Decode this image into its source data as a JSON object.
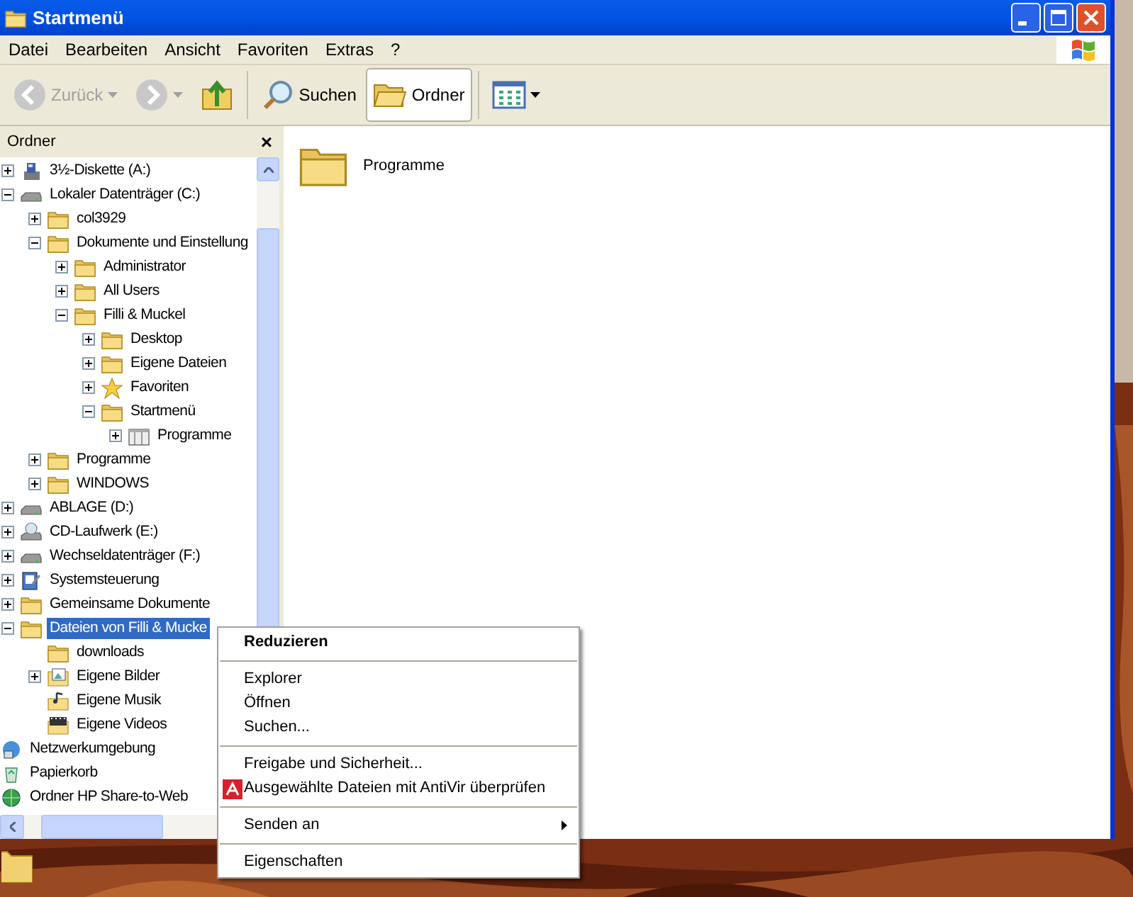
{
  "window": {
    "title": "Startmenü"
  },
  "menu_bar": [
    "Datei",
    "Bearbeiten",
    "Ansicht",
    "Favoriten",
    "Extras",
    "?"
  ],
  "toolbar": [
    {
      "kind": "back",
      "label": "Zurück",
      "disabled": true,
      "dropdown": true,
      "selected": false
    },
    {
      "kind": "forward",
      "disabled": true,
      "dropdown": true,
      "selected": false
    },
    {
      "kind": "up",
      "disabled": false,
      "dropdown": false,
      "selected": false
    },
    {
      "kind": "search",
      "label": "Suchen",
      "disabled": false,
      "dropdown": false,
      "selected": false
    },
    {
      "kind": "folders",
      "label": "Ordner",
      "disabled": false,
      "dropdown": false,
      "selected": true
    },
    {
      "kind": "views",
      "disabled": false,
      "dropdown": true,
      "selected": false
    }
  ],
  "folder_pane": {
    "title": "Ordner",
    "close": "×",
    "tree": [
      {
        "label": "3½-Diskette (A:)",
        "kind": "floppy",
        "expanded": false,
        "selected": false
      },
      {
        "label": "Lokaler Datenträger (C:)",
        "kind": "drive",
        "expanded": true,
        "selected": false,
        "children": [
          {
            "label": "col3929",
            "kind": "folder",
            "expanded": false,
            "selected": false
          },
          {
            "label": "Dokumente und Einstellung",
            "kind": "folder",
            "expanded": true,
            "selected": false,
            "children": [
              {
                "label": "Administrator",
                "kind": "folder",
                "expanded": false,
                "selected": false
              },
              {
                "label": "All Users",
                "kind": "folder",
                "expanded": false,
                "selected": false
              },
              {
                "label": "Filli & Muckel",
                "kind": "folder",
                "expanded": true,
                "selected": false,
                "children": [
                  {
                    "label": "Desktop",
                    "kind": "folder",
                    "expanded": false,
                    "selected": false
                  },
                  {
                    "label": "Eigene Dateien",
                    "kind": "folder",
                    "expanded": false,
                    "selected": false
                  },
                  {
                    "label": "Favoriten",
                    "kind": "star",
                    "expanded": false,
                    "selected": false
                  },
                  {
                    "label": "Startmenü",
                    "kind": "folder",
                    "expanded": true,
                    "selected": false,
                    "children": [
                      {
                        "label": "Programme",
                        "kind": "programs",
                        "expanded": false,
                        "selected": false
                      }
                    ]
                  }
                ]
              }
            ]
          },
          {
            "label": "Programme",
            "kind": "folder",
            "expanded": false,
            "selected": false
          },
          {
            "label": "WINDOWS",
            "kind": "folder",
            "expanded": false,
            "selected": false
          }
        ]
      },
      {
        "label": "ABLAGE (D:)",
        "kind": "drive",
        "expanded": false,
        "selected": false
      },
      {
        "label": "CD-Laufwerk (E:)",
        "kind": "cdrom",
        "expanded": false,
        "selected": false
      },
      {
        "label": "Wechseldatenträger (F:)",
        "kind": "drive",
        "expanded": false,
        "selected": false
      },
      {
        "label": "Systemsteuerung",
        "kind": "control",
        "expanded": false,
        "selected": false
      },
      {
        "label": "Gemeinsame Dokumente",
        "kind": "folder",
        "expanded": false,
        "selected": false
      },
      {
        "label": "Dateien von Filli & Mucke",
        "kind": "folder",
        "expanded": true,
        "selected": true,
        "children": [
          {
            "label": "downloads",
            "kind": "folder",
            "selected": false
          },
          {
            "label": "Eigene Bilder",
            "kind": "pictures",
            "expanded": false,
            "selected": false
          },
          {
            "label": "Eigene Musik",
            "kind": "music",
            "selected": false
          },
          {
            "label": "Eigene Videos",
            "kind": "videos",
            "selected": false
          }
        ]
      },
      {
        "label": "Netzwerkumgebung",
        "kind": "network",
        "selected": false
      },
      {
        "label": "Papierkorb",
        "kind": "recycle",
        "selected": false
      },
      {
        "label": "Ordner HP Share-to-Web",
        "kind": "web",
        "selected": false
      }
    ]
  },
  "content": {
    "items": [
      {
        "label": "Programme",
        "kind": "folder"
      }
    ]
  },
  "context_menu": [
    {
      "kind": "item",
      "label": "Reduzieren",
      "default": true
    },
    {
      "kind": "separator"
    },
    {
      "kind": "item",
      "label": "Explorer",
      "default": false
    },
    {
      "kind": "item",
      "label": "Öffnen",
      "default": false
    },
    {
      "kind": "item",
      "label": "Suchen...",
      "default": false
    },
    {
      "kind": "separator"
    },
    {
      "kind": "item",
      "label": "Freigabe und Sicherheit...",
      "default": false
    },
    {
      "kind": "antivir",
      "label": "Ausgewählte Dateien mit AntiVir überprüfen",
      "default": false
    },
    {
      "kind": "separator"
    },
    {
      "kind": "submenu",
      "label": "Senden an",
      "default": false
    },
    {
      "kind": "separator"
    },
    {
      "kind": "item",
      "label": "Eigenschaften",
      "default": false
    }
  ]
}
